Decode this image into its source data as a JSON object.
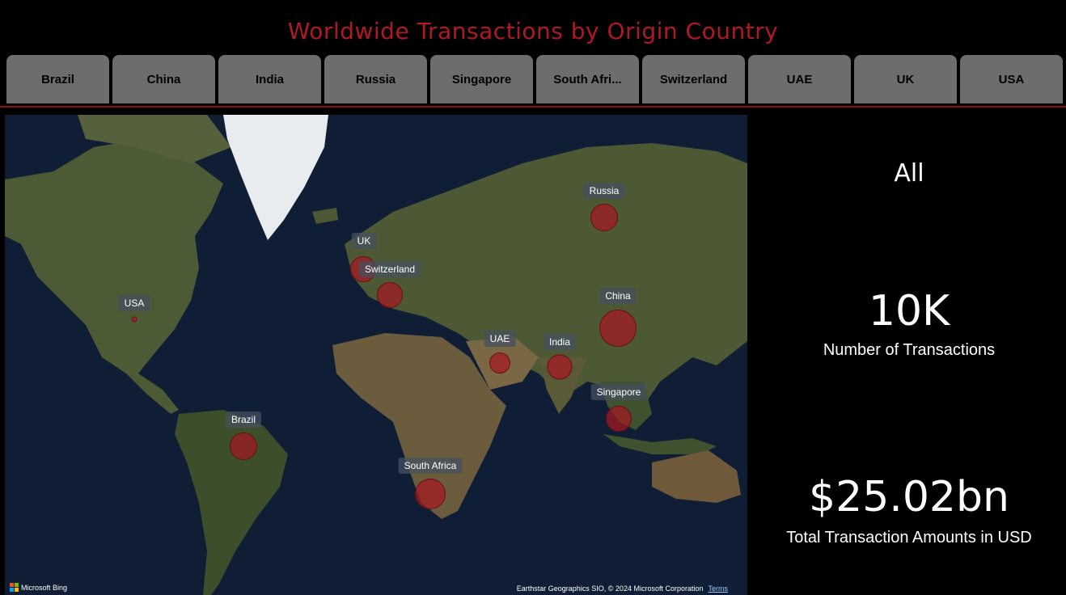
{
  "title": "Worldwide Transactions by Origin Country",
  "slicer": {
    "items": [
      "Brazil",
      "China",
      "India",
      "Russia",
      "Singapore",
      "South Afri...",
      "Switzerland",
      "UAE",
      "UK",
      "USA"
    ]
  },
  "map": {
    "bubble_color": "#a51923",
    "markers": [
      {
        "label": "Russia",
        "size": "medium"
      },
      {
        "label": "UK",
        "size": "medium"
      },
      {
        "label": "Switzerland",
        "size": "medium"
      },
      {
        "label": "USA",
        "size": "tiny"
      },
      {
        "label": "China",
        "size": "large"
      },
      {
        "label": "UAE",
        "size": "small"
      },
      {
        "label": "India",
        "size": "medium"
      },
      {
        "label": "Singapore",
        "size": "medium"
      },
      {
        "label": "Brazil",
        "size": "medium"
      },
      {
        "label": "South Africa",
        "size": "medium"
      }
    ],
    "brand": "Microsoft Bing",
    "attribution": "Earthstar Geographics SIO, © 2024 Microsoft Corporation",
    "terms_link": "Terms"
  },
  "kpis": {
    "filter_value": "All",
    "transactions_value": "10K",
    "transactions_label": "Number of Transactions",
    "amount_value": "$25.02bn",
    "amount_label": "Total Transaction Amounts in USD"
  },
  "colors": {
    "title": "#b01824",
    "slicer_button": "#6d6d6d",
    "divider": "#8c1019",
    "background": "#000000"
  }
}
